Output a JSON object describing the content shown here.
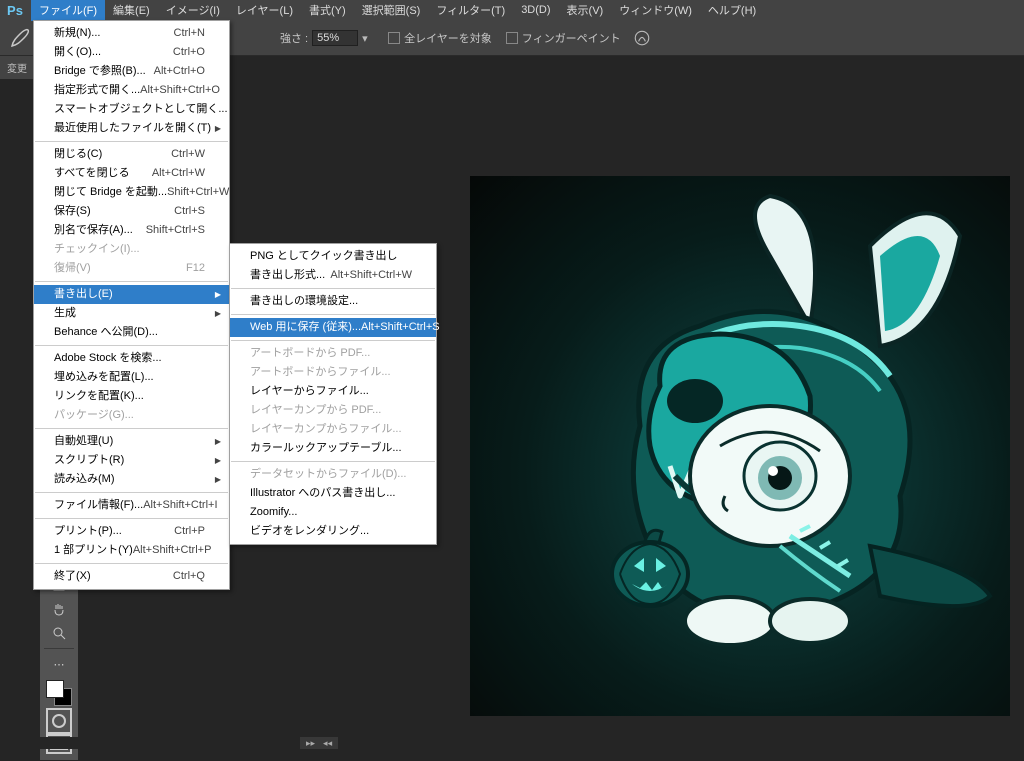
{
  "app": {
    "name": "Ps"
  },
  "menubar": [
    "ファイル(F)",
    "編集(E)",
    "イメージ(I)",
    "レイヤー(L)",
    "書式(Y)",
    "選択範囲(S)",
    "フィルター(T)",
    "3D(D)",
    "表示(V)",
    "ウィンドウ(W)",
    "ヘルプ(H)"
  ],
  "optionbar": {
    "change_label": "変更",
    "strength_label": "強さ :",
    "strength_value": "55%",
    "all_layers": "全レイヤーを対象",
    "finger_paint": "フィンガーペイント"
  },
  "file_menu": {
    "sections": [
      [
        {
          "l": "新規(N)...",
          "s": "Ctrl+N"
        },
        {
          "l": "開く(O)...",
          "s": "Ctrl+O"
        },
        {
          "l": "Bridge で参照(B)...",
          "s": "Alt+Ctrl+O"
        },
        {
          "l": "指定形式で開く...",
          "s": "Alt+Shift+Ctrl+O"
        },
        {
          "l": "スマートオブジェクトとして開く...",
          "s": ""
        },
        {
          "l": "最近使用したファイルを開く(T)",
          "s": "",
          "sub": true
        }
      ],
      [
        {
          "l": "閉じる(C)",
          "s": "Ctrl+W"
        },
        {
          "l": "すべてを閉じる",
          "s": "Alt+Ctrl+W"
        },
        {
          "l": "閉じて Bridge を起動...",
          "s": "Shift+Ctrl+W"
        },
        {
          "l": "保存(S)",
          "s": "Ctrl+S"
        },
        {
          "l": "別名で保存(A)...",
          "s": "Shift+Ctrl+S"
        },
        {
          "l": "チェックイン(I)...",
          "s": "",
          "dis": true
        },
        {
          "l": "復帰(V)",
          "s": "F12",
          "dis": true
        }
      ],
      [
        {
          "l": "書き出し(E)",
          "s": "",
          "hl": true,
          "sub": true
        },
        {
          "l": "生成",
          "s": "",
          "sub": true
        },
        {
          "l": "Behance へ公開(D)...",
          "s": ""
        }
      ],
      [
        {
          "l": "Adobe Stock を検索...",
          "s": ""
        },
        {
          "l": "埋め込みを配置(L)...",
          "s": ""
        },
        {
          "l": "リンクを配置(K)...",
          "s": ""
        },
        {
          "l": "パッケージ(G)...",
          "s": "",
          "dis": true
        }
      ],
      [
        {
          "l": "自動処理(U)",
          "s": "",
          "sub": true
        },
        {
          "l": "スクリプト(R)",
          "s": "",
          "sub": true
        },
        {
          "l": "読み込み(M)",
          "s": "",
          "sub": true
        }
      ],
      [
        {
          "l": "ファイル情報(F)...",
          "s": "Alt+Shift+Ctrl+I"
        }
      ],
      [
        {
          "l": "プリント(P)...",
          "s": "Ctrl+P"
        },
        {
          "l": "1 部プリント(Y)",
          "s": "Alt+Shift+Ctrl+P"
        }
      ],
      [
        {
          "l": "終了(X)",
          "s": "Ctrl+Q"
        }
      ]
    ]
  },
  "export_submenu": {
    "sections": [
      [
        {
          "l": "PNG としてクイック書き出し",
          "s": ""
        },
        {
          "l": "書き出し形式...",
          "s": "Alt+Shift+Ctrl+W"
        }
      ],
      [
        {
          "l": "書き出しの環境設定...",
          "s": ""
        }
      ],
      [
        {
          "l": "Web 用に保存 (従来)...",
          "s": "Alt+Shift+Ctrl+S",
          "hl": true
        }
      ],
      [
        {
          "l": "アートボードから PDF...",
          "s": "",
          "dis": true
        },
        {
          "l": "アートボードからファイル...",
          "s": "",
          "dis": true
        },
        {
          "l": "レイヤーからファイル...",
          "s": ""
        },
        {
          "l": "レイヤーカンプから PDF...",
          "s": "",
          "dis": true
        },
        {
          "l": "レイヤーカンプからファイル...",
          "s": "",
          "dis": true
        },
        {
          "l": "カラールックアップテーブル...",
          "s": ""
        }
      ],
      [
        {
          "l": "データセットからファイル(D)...",
          "s": "",
          "dis": true
        },
        {
          "l": "Illustrator へのパス書き出し...",
          "s": ""
        },
        {
          "l": "Zoomify...",
          "s": ""
        },
        {
          "l": "ビデオをレンダリング...",
          "s": ""
        }
      ]
    ]
  }
}
